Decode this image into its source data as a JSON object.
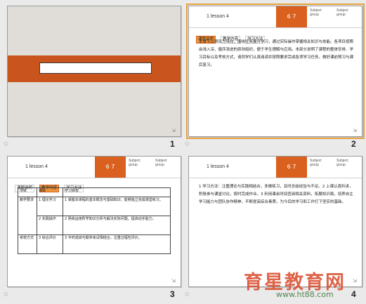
{
  "slides": [
    {
      "number": "1",
      "type": "title"
    },
    {
      "number": "2",
      "type": "text",
      "header": {
        "label": "1  lesson 4",
        "badge": "6 7",
        "right1": "Subject group",
        "right2": "Subject group"
      },
      "tabs": [
        "课程说明",
        "教学内容",
        "学习方法"
      ],
      "active_tab": 0,
      "text": "本章节以项目为导向，围绕任务展开学习，通过实际操作掌握相关知识与技能。各项目按照由浅入深、循序渐进的原则组织，便于学生理解与应用。本部分说明了课程的整体安排、学习目标以及考核方式，请同学们认真阅读并按照要求完成各项学习任务，做好课前预习与课后复习。"
    },
    {
      "number": "3",
      "type": "table",
      "header": {
        "label": "1  lesson 4",
        "badge": "6 7",
        "right1": "Subject group",
        "right2": "Subject group"
      },
      "tabs": [
        "课程说明",
        "教学内容",
        "学习方法"
      ],
      "active_tab": 1,
      "table": {
        "headers": [
          "项目",
          "课目",
          "学习目标"
        ],
        "rows": [
          [
            "教学要求",
            "1 理论学习",
            "1 掌握本课程的基本概念与基础知识，能够独立完成课堂练习。"
          ],
          [
            "",
            "2 实践操作",
            "2 熟练运用所学知识分析与解决实际问题，提高动手能力。"
          ],
          [
            "考核方式",
            "3 综合评价",
            "3 平时成绩与期末考试相结合，注重过程性评价。"
          ]
        ]
      }
    },
    {
      "number": "4",
      "type": "text",
      "header": {
        "label": "1  lesson 4",
        "badge": "6 7",
        "right1": "Subject group",
        "right2": "Subject group"
      },
      "tabs": [
        "课程说明",
        "教学内容",
        "学习方法"
      ],
      "active_tab": 2,
      "text": "1 学习方法：注重理论与实践相结合，多做练习，及时总结经验与不足。2 上课认真听讲，积极参与课堂讨论，按时完成作业。3 利用课余时间查阅相关资料，拓展知识面，培养自主学习能力与团队协作精神，不断提高综合素质，为今后的学习和工作打下坚实的基础。"
    }
  ],
  "selected_slide": 1,
  "corner_glyph": "⇲",
  "star_glyph": "☆",
  "watermark": {
    "main": "育星教育网",
    "sub": "www.ht88.com"
  }
}
